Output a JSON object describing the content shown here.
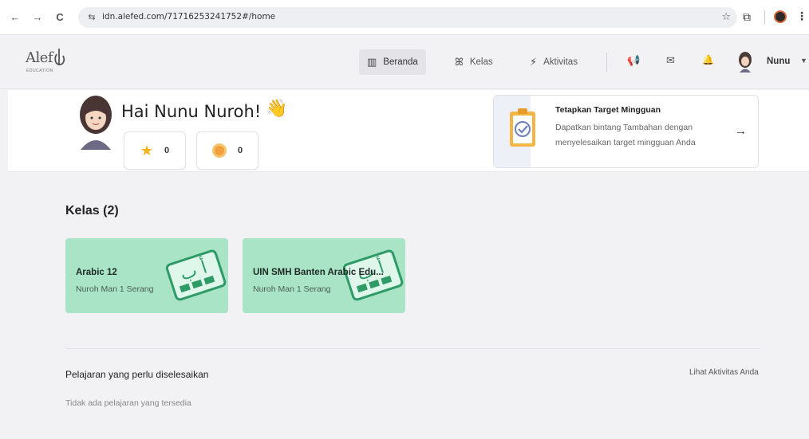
{
  "browser": {
    "back_icon": "←",
    "forward_icon": "→",
    "reload_icon": "C",
    "site_info_icon": "⇆",
    "url": "idn.alefed.com/71716253241752#/home",
    "bookmark_icon": "☆",
    "extensions_icon": "⧉",
    "menu_icon": "⋮"
  },
  "header": {
    "logo_text": "Alef",
    "logo_sub": "EDUCATION",
    "nav": [
      {
        "label": "Beranda",
        "icon": "▥"
      },
      {
        "label": "Kelas",
        "icon": "ꕤ"
      },
      {
        "label": "Aktivitas",
        "icon": "⚡"
      }
    ],
    "announce_icon": "📢",
    "mail_icon": "✉",
    "bell_icon": "🔔",
    "user_name": "Nunu",
    "caret": "▼"
  },
  "welcome": {
    "greeting": "Hai Nunu Nuroh!",
    "wave": "👋",
    "stars": "0",
    "coins": "0"
  },
  "target": {
    "title": "Tetapkan Target Mingguan",
    "description": "Dapatkan bintang Tambahan dengan menyelesaikan target mingguan Anda",
    "arrow": "→"
  },
  "classes": {
    "title": "Kelas (2)",
    "items": [
      {
        "name": "Arabic 12",
        "school": "Nuroh Man 1 Serang"
      },
      {
        "name": "UIN SMH Banten Arabic Edu...",
        "school": "Nuroh Man 1 Serang"
      }
    ]
  },
  "lessons": {
    "title": "Pelajaran yang perlu diselesaikan",
    "link": "Lihat Aktivitas Anda",
    "empty": "Tidak ada pelajaran yang tersedia"
  }
}
